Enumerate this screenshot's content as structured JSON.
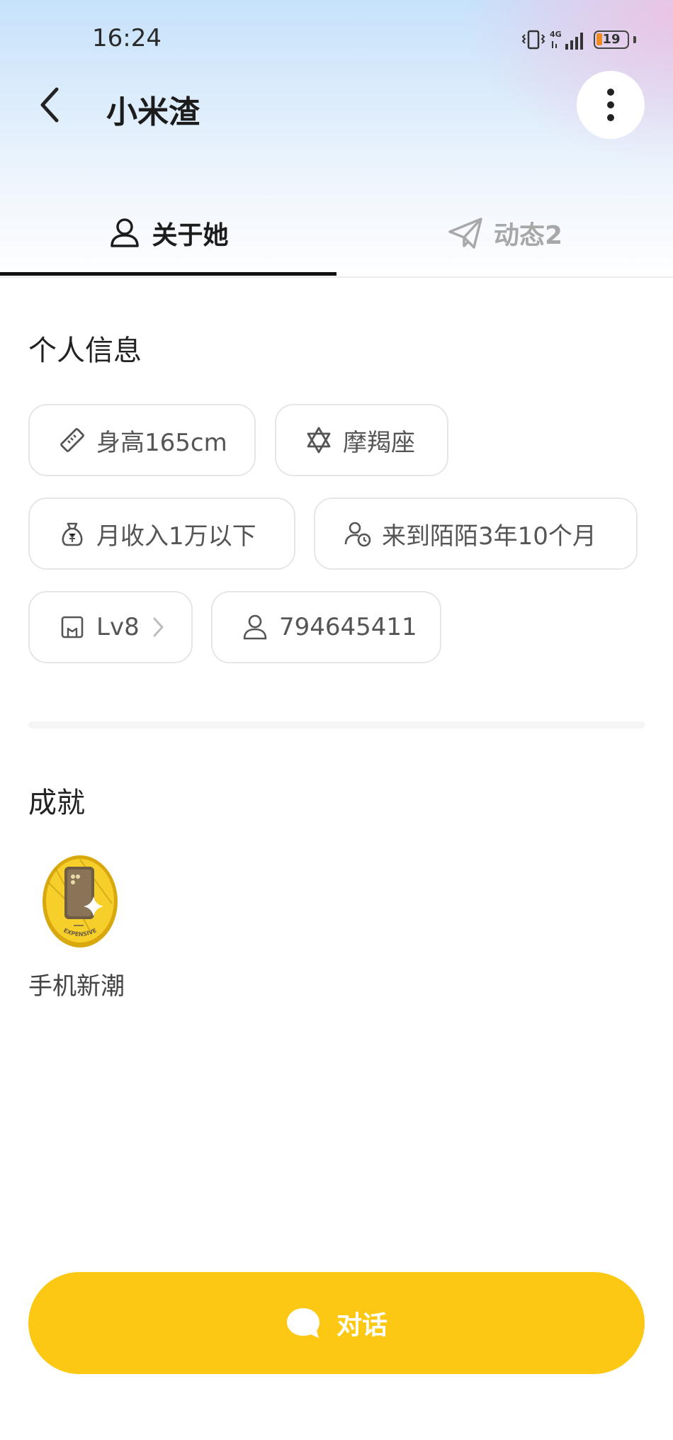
{
  "status_bar": {
    "time": "16:24",
    "network": "4G",
    "battery_level": "19"
  },
  "header": {
    "title": "小米渣"
  },
  "tabs": [
    {
      "label": "关于她",
      "active": true
    },
    {
      "label": "动态2",
      "active": false
    }
  ],
  "personal_info": {
    "title": "个人信息",
    "chips": {
      "height": "身高165cm",
      "zodiac": "摩羯座",
      "income": "月收入1万以下",
      "joined": "来到陌陌3年10个月",
      "level": "Lv8",
      "user_id": "794645411"
    }
  },
  "achievements": {
    "title": "成就",
    "items": [
      {
        "label": "手机新潮",
        "badge_text": "EXPENSIVE"
      }
    ]
  },
  "chat_button": {
    "label": "对话"
  },
  "colors": {
    "accent": "#fcc813",
    "tab_active": "#111111",
    "tab_inactive": "#a8a8a8"
  }
}
